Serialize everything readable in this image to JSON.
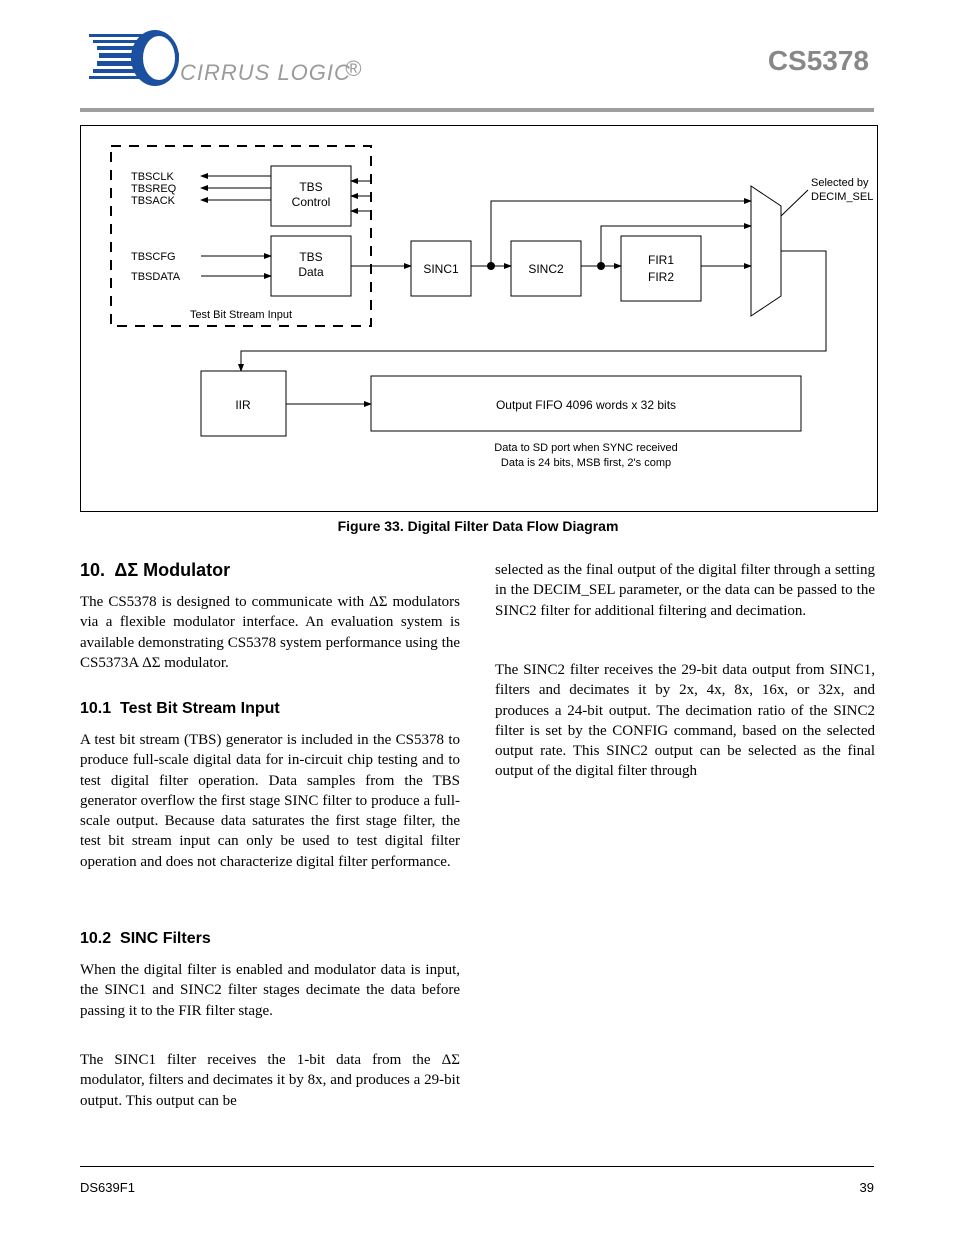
{
  "header": {
    "brand": "CIRRUS LOGIC",
    "chip": "CS5378"
  },
  "figure": {
    "caption": "Figure 33. Digital Filter Data Flow Diagram",
    "blocks": {
      "tbsctrl": "TBS\nControl",
      "tbsdata": "TBS\nData",
      "sinc1": "SINC1",
      "sinc2": "SINC2",
      "fir": "FIR1\nFIR2",
      "iir": "IIR",
      "fifo": "Output FIFO 4096 words x 32 bits"
    },
    "signals": {
      "in": [
        "TBSCLK",
        "TBSREQ",
        "TBSACK",
        "TBSCFG",
        "TBSDATA"
      ],
      "dash": "Test Bit Stream Input",
      "muxout": "Selected by DECIM_SEL",
      "fifonotes": [
        "Data to SD port when SYNC received",
        "Data is 24 bits, MSB first, 2's comp"
      ]
    }
  },
  "sec_dsm": {
    "num": "10.",
    "title": "ΔΣ Modulator",
    "p": "The CS5378 is designed to communicate with ΔΣ modulators via a flexible modulator interface. An evaluation system is available demonstrating CS5378 system performance using the CS5373A ΔΣ modulator."
  },
  "sec_tbs": {
    "num": "10.1",
    "title": "Test Bit Stream Input",
    "p": "A test bit stream (TBS) generator is included in the CS5378 to produce full-scale digital data for in-circuit chip testing and to test digital filter operation. Data samples from the TBS generator overflow the first stage SINC filter to produce a full-scale output. Because data saturates the first stage filter, the test bit stream input can only be used to test digital filter operation and does not characterize digital filter performance."
  },
  "sec_sinc": {
    "num": "10.2",
    "title": "SINC Filters",
    "p1": "When the digital filter is enabled and modulator data is input, the SINC1 and SINC2 filter stages decimate the data before passing it to the FIR filter stage.",
    "p2": "The SINC1 filter receives the 1-bit data from the ΔΣ modulator, filters and decimates it by 8x, and produces a 29-bit output. This output can be selected as the final output of the digital filter through a setting in the DECIM_SEL parameter, or the data can be passed to the SINC2 filter for additional filtering and decimation.",
    "p3": "The SINC2 filter receives the 29-bit data output from SINC1, filters and decimates it by 2x, 4x, 8x, 16x, or 32x, and produces a 24-bit output. The decimation ratio of the SINC2 filter is set by the CONFIG command, based on the selected output rate. This SINC2 output can be selected as the final output of the digital filter through"
  },
  "footer": {
    "left": "DS639F1",
    "right": "39"
  }
}
